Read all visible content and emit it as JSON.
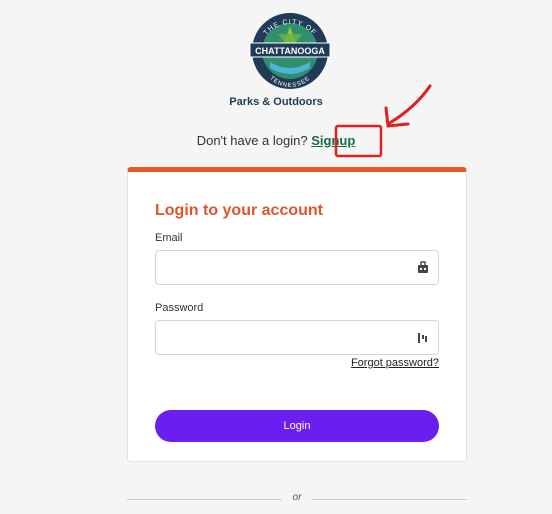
{
  "branding": {
    "logo_top_text": "THE CITY OF",
    "logo_name": "CHATTANOOGA",
    "logo_bottom_text": "TENNESSEE",
    "org_label": "Parks & Outdoors"
  },
  "signup_prompt": {
    "text": "Don't have a login?",
    "link_label": "Signup"
  },
  "login_card": {
    "title": "Login to your account",
    "email_label": "Email",
    "email_value": "",
    "password_label": "Password",
    "password_value": "",
    "forgot_label": "Forgot password?",
    "login_label": "Login"
  },
  "divider": {
    "label": "or"
  },
  "colors": {
    "accent_orange": "#e8562a",
    "button_purple": "#6b1ef0",
    "signup_green": "#1b6b45",
    "annotation_red": "#e0201e",
    "logo_navy": "#1f3b57"
  },
  "icons": {
    "email_field_icon": "password-manager-icon",
    "password_field_icon": "password-manager-icon",
    "annotation": "red-arrow-and-box"
  }
}
